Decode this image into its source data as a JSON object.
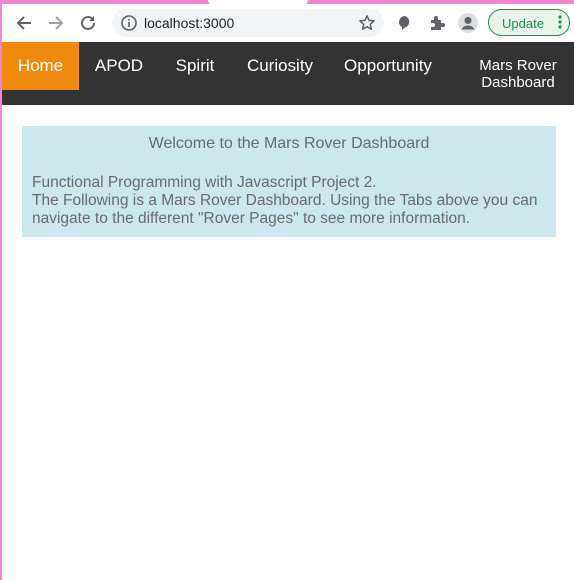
{
  "browser": {
    "url": "localhost:3000",
    "update_label": "Update",
    "icons": [
      "back-icon",
      "forward-icon",
      "reload-icon",
      "info-icon",
      "star-icon",
      "extension-puzzle-icon",
      "profile-icon",
      "more-vert-icon"
    ]
  },
  "nav": {
    "items": [
      {
        "label": "Home",
        "active": true
      },
      {
        "label": "APOD",
        "active": false
      },
      {
        "label": "Spirit",
        "active": false
      },
      {
        "label": "Curiosity",
        "active": false
      },
      {
        "label": "Opportunity",
        "active": false
      }
    ],
    "brand_line1": "Mars Rover",
    "brand_line2": "Dashboard"
  },
  "card": {
    "heading": "Welcome to the Mars Rover Dashboard",
    "line1": "Functional Programming with Javascript Project 2.",
    "line2": "The Following is a Mars Rover Dashboard. Using the Tabs above you can navigate to the different \"Rover Pages\" to see more information."
  },
  "colors": {
    "frame": "#ef86d1",
    "navbar": "#333333",
    "active_tab": "#f08a0e",
    "card": "#cce7ee",
    "update_green": "#1e8e3e"
  }
}
